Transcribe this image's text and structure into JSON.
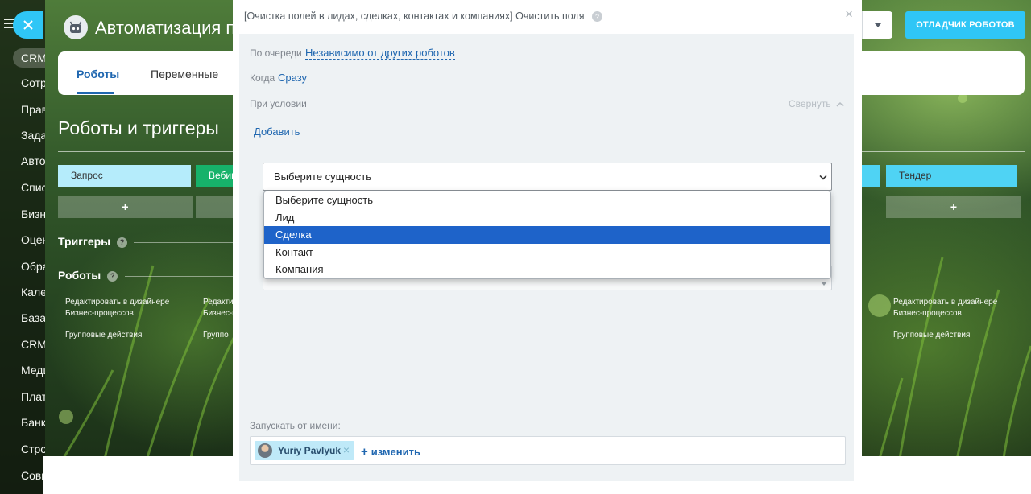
{
  "left_nav": {
    "items": [
      {
        "label": "CRM",
        "active": true
      },
      {
        "label": "Сотрудники"
      },
      {
        "label": "Права"
      },
      {
        "label": "Задачи"
      },
      {
        "label": "Автоматизация"
      },
      {
        "label": "Списки"
      },
      {
        "label": "Бизнес-процессы"
      },
      {
        "label": "Оценка"
      },
      {
        "label": "Образование"
      },
      {
        "label": "Календарь"
      },
      {
        "label": "База знаний"
      },
      {
        "label": "CRM"
      },
      {
        "label": "Медиа"
      },
      {
        "label": "Платформа"
      },
      {
        "label": "Банк"
      },
      {
        "label": "Строительство"
      },
      {
        "label": "Совместная работа"
      }
    ]
  },
  "header": {
    "app_title": "Автоматизация пр",
    "debug_button": "ОТЛАДЧИК РОБОТОВ"
  },
  "page": {
    "tabs": [
      {
        "label": "Роботы",
        "active": true
      },
      {
        "label": "Переменные"
      }
    ],
    "heading": "Роботы и триггеры",
    "stages": [
      {
        "label": "Запрос",
        "color": "#b5ecfb",
        "text_color": "#333"
      },
      {
        "label": "Вебин",
        "color": "#17b26a",
        "text_color": "#fff"
      },
      {
        "label": "Тендер",
        "color": "#4fd3f4",
        "text_color": "#333"
      }
    ],
    "plus_label": "+",
    "triggers_label": "Триггеры",
    "robots_label": "Роботы",
    "help_glyph": "?",
    "edit_in_designer": "Редактировать в дизайнере Бизнес-процессов",
    "edit_short_1": "Редактиро",
    "edit_short_2": "Бизнес-п",
    "group_actions": "Групповые действия",
    "group_short": "Группо"
  },
  "dialog": {
    "title": "[Очистка полей в лидах, сделках, контактах и компаниях] Очистить поля",
    "close_glyph": "×",
    "queue_label": "По очереди",
    "queue_value": "Независимо от других роботов",
    "when_label": "Когда",
    "when_value": "Сразу",
    "condition_label": "При условии",
    "collapse_label": "Свернуть",
    "add_label": "Добавить",
    "entity_select": {
      "selected": "Выберите сущность",
      "options": [
        "Выберите сущность",
        "Лид",
        "Сделка",
        "Контакт",
        "Компания"
      ],
      "highlighted": "Сделка"
    },
    "run_as_label": "Запускать от имени:",
    "run_as_user": "Yuriy Pavlyuk",
    "remove_glyph": "×",
    "change_label": "изменить",
    "change_plus": "+"
  }
}
